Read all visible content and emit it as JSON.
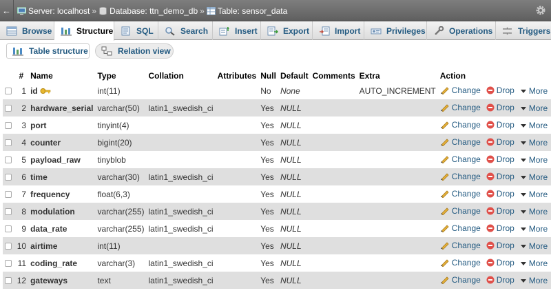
{
  "breadcrumb": {
    "back_glyph": "←",
    "server": "Server: localhost",
    "database": "Database: ttn_demo_db",
    "table": "Table: sensor_data",
    "separator": "»"
  },
  "tabs": [
    {
      "label": "Browse",
      "icon": "browse-icon"
    },
    {
      "label": "Structure",
      "icon": "structure-icon",
      "active": true
    },
    {
      "label": "SQL",
      "icon": "sql-icon"
    },
    {
      "label": "Search",
      "icon": "search-icon"
    },
    {
      "label": "Insert",
      "icon": "insert-icon"
    },
    {
      "label": "Export",
      "icon": "export-icon"
    },
    {
      "label": "Import",
      "icon": "import-icon"
    },
    {
      "label": "Privileges",
      "icon": "privileges-icon"
    },
    {
      "label": "Operations",
      "icon": "operations-icon"
    },
    {
      "label": "Triggers",
      "icon": "triggers-icon"
    }
  ],
  "subtabs": {
    "table_structure": "Table structure",
    "relation_view": "Relation view"
  },
  "columns": [
    "#",
    "Name",
    "Type",
    "Collation",
    "Attributes",
    "Null",
    "Default",
    "Comments",
    "Extra",
    "Action"
  ],
  "actions": {
    "change": "Change",
    "drop": "Drop",
    "more": "More"
  },
  "rows": [
    {
      "num": "1",
      "name": "id",
      "type": "int(11)",
      "collation": "",
      "attributes": "",
      "null": "No",
      "default": "None",
      "comments": "",
      "extra": "AUTO_INCREMENT",
      "primary_key": true
    },
    {
      "num": "2",
      "name": "hardware_serial",
      "type": "varchar(50)",
      "collation": "latin1_swedish_ci",
      "attributes": "",
      "null": "Yes",
      "default": "NULL",
      "comments": "",
      "extra": ""
    },
    {
      "num": "3",
      "name": "port",
      "type": "tinyint(4)",
      "collation": "",
      "attributes": "",
      "null": "Yes",
      "default": "NULL",
      "comments": "",
      "extra": ""
    },
    {
      "num": "4",
      "name": "counter",
      "type": "bigint(20)",
      "collation": "",
      "attributes": "",
      "null": "Yes",
      "default": "NULL",
      "comments": "",
      "extra": ""
    },
    {
      "num": "5",
      "name": "payload_raw",
      "type": "tinyblob",
      "collation": "",
      "attributes": "",
      "null": "Yes",
      "default": "NULL",
      "comments": "",
      "extra": ""
    },
    {
      "num": "6",
      "name": "time",
      "type": "varchar(30)",
      "collation": "latin1_swedish_ci",
      "attributes": "",
      "null": "Yes",
      "default": "NULL",
      "comments": "",
      "extra": ""
    },
    {
      "num": "7",
      "name": "frequency",
      "type": "float(6,3)",
      "collation": "",
      "attributes": "",
      "null": "Yes",
      "default": "NULL",
      "comments": "",
      "extra": ""
    },
    {
      "num": "8",
      "name": "modulation",
      "type": "varchar(255)",
      "collation": "latin1_swedish_ci",
      "attributes": "",
      "null": "Yes",
      "default": "NULL",
      "comments": "",
      "extra": ""
    },
    {
      "num": "9",
      "name": "data_rate",
      "type": "varchar(255)",
      "collation": "latin1_swedish_ci",
      "attributes": "",
      "null": "Yes",
      "default": "NULL",
      "comments": "",
      "extra": ""
    },
    {
      "num": "10",
      "name": "airtime",
      "type": "int(11)",
      "collation": "",
      "attributes": "",
      "null": "Yes",
      "default": "NULL",
      "comments": "",
      "extra": ""
    },
    {
      "num": "11",
      "name": "coding_rate",
      "type": "varchar(3)",
      "collation": "latin1_swedish_ci",
      "attributes": "",
      "null": "Yes",
      "default": "NULL",
      "comments": "",
      "extra": ""
    },
    {
      "num": "12",
      "name": "gateways",
      "type": "text",
      "collation": "latin1_swedish_ci",
      "attributes": "",
      "null": "Yes",
      "default": "NULL",
      "comments": "",
      "extra": ""
    }
  ],
  "colors": {
    "link": "#235a81",
    "drop_red": "#e0504a",
    "pencil": "#d8a22a",
    "key_gold": "#e0b030",
    "row_alt": "#dfdfdf"
  }
}
